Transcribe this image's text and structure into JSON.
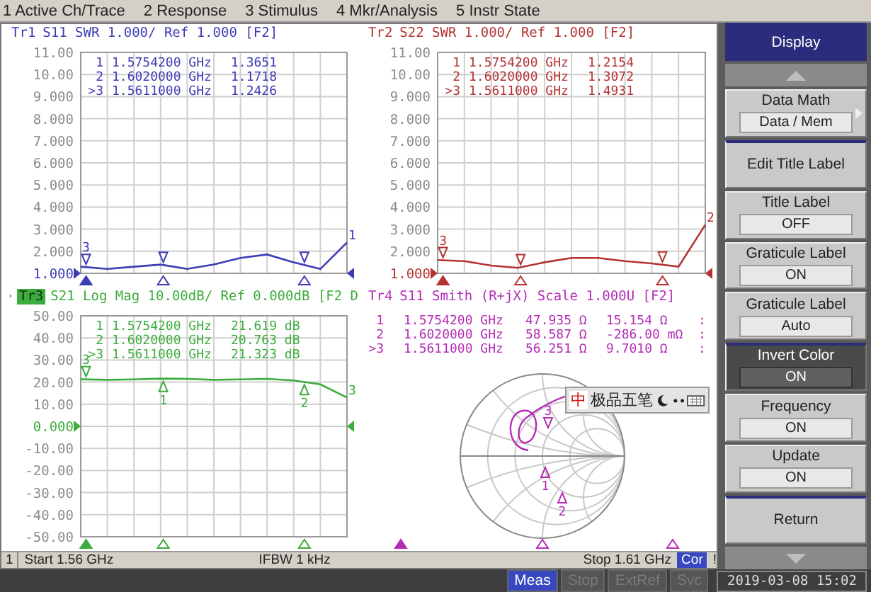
{
  "menu": [
    {
      "label": "1 Active Ch/Trace"
    },
    {
      "label": "2 Response"
    },
    {
      "label": "3 Stimulus"
    },
    {
      "label": "4 Mkr/Analysis"
    },
    {
      "label": "5 Instr State"
    }
  ],
  "traces": [
    {
      "kind": "swr",
      "badge": "Tr1",
      "active": false,
      "color": "#3c3cb4",
      "end_label": "1",
      "markers": [
        {
          "label": "1",
          "frequency": "1.5754200 GHz",
          "values": [
            "1.3651"
          ],
          "active": false
        },
        {
          "label": "2",
          "frequency": "1.6020000 GHz",
          "values": [
            "1.1718"
          ],
          "active": false
        },
        {
          "kind": "above",
          "label": ">3",
          "frequency": "1.5611000 GHz",
          "values": [
            "1.2426"
          ],
          "active": true,
          "plot_label": "3"
        }
      ],
      "chart_data": {
        "type": "line",
        "title": "S11 SWR 1.000/ Ref 1.000 [F2]",
        "grid": true,
        "categories": [
          null,
          null,
          null,
          null,
          null,
          null,
          null,
          null,
          null,
          null,
          null
        ],
        "ylim": [
          1,
          11
        ],
        "series": [
          {
            "color": "#3c3cb4",
            "values": [
              1.3,
              1.2,
              1.3,
              1.4,
              1.2,
              1.4,
              1.7,
              1.85,
              1.5,
              1.2,
              2.4
            ]
          }
        ],
        "yticks": [
          {
            "value": 1,
            "label": "1.000"
          },
          {
            "value": 2,
            "label": "2.000"
          },
          {
            "value": 3,
            "label": "3.000"
          },
          {
            "value": 4,
            "label": "4.000"
          },
          {
            "value": 5,
            "label": "5.000"
          },
          {
            "value": 6,
            "label": "6.000"
          },
          {
            "value": 7,
            "label": "7.000"
          },
          {
            "value": 8,
            "label": "8.000"
          },
          {
            "value": 9,
            "label": "9.000"
          },
          {
            "value": 10,
            "label": "10.00"
          },
          {
            "value": 11,
            "label": "11.00"
          }
        ]
      }
    },
    {
      "kind": "swr",
      "badge": "Tr2",
      "active": false,
      "color": "#b43232",
      "end_label": "2",
      "markers": [
        {
          "label": "1",
          "frequency": "1.5754200 GHz",
          "values": [
            "1.2154"
          ],
          "active": false
        },
        {
          "label": "2",
          "frequency": "1.6020000 GHz",
          "values": [
            "1.3072"
          ],
          "active": false
        },
        {
          "kind": "above",
          "label": ">3",
          "frequency": "1.5611000 GHz",
          "values": [
            "1.4931"
          ],
          "active": true,
          "plot_label": "3"
        }
      ],
      "chart_data": {
        "type": "line",
        "title": "S22 SWR 1.000/ Ref 1.000 [F2]",
        "grid": true,
        "categories": [
          null,
          null,
          null,
          null,
          null,
          null,
          null,
          null,
          null,
          null,
          null
        ],
        "ylim": [
          1,
          11
        ],
        "series": [
          {
            "color": "#b43232",
            "values": [
              1.6,
              1.55,
              1.35,
              1.25,
              1.5,
              1.7,
              1.7,
              1.55,
              1.45,
              1.3,
              3.2
            ]
          }
        ],
        "yticks": [
          {
            "value": 1,
            "label": "1.000"
          },
          {
            "value": 2,
            "label": "2.000"
          },
          {
            "value": 3,
            "label": "3.000"
          },
          {
            "value": 4,
            "label": "4.000"
          },
          {
            "value": 5,
            "label": "5.000"
          },
          {
            "value": 6,
            "label": "6.000"
          },
          {
            "value": 7,
            "label": "7.000"
          },
          {
            "value": 8,
            "label": "8.000"
          },
          {
            "value": 9,
            "label": "9.000"
          },
          {
            "value": 10,
            "label": "10.00"
          },
          {
            "value": 11,
            "label": "11.00"
          }
        ]
      }
    },
    {
      "kind": "logmag",
      "badge": "Tr3",
      "active": true,
      "color": "#3cac3c",
      "end_label": "3",
      "markers": [
        {
          "kind": "below",
          "label": "1",
          "frequency": "1.5754200 GHz",
          "values": [
            "21.619 dB"
          ],
          "active": false,
          "plot_label": "1"
        },
        {
          "kind": "below",
          "label": "2",
          "frequency": "1.6020000 GHz",
          "values": [
            "20.763 dB"
          ],
          "active": false,
          "plot_label": "2"
        },
        {
          "kind": "above",
          "label": ">3",
          "frequency": "1.5611000 GHz",
          "values": [
            "21.323 dB"
          ],
          "active": true,
          "plot_label": "3"
        }
      ],
      "chart_data": {
        "type": "line",
        "title": "S21 Log Mag 10.00dB/ Ref 0.000dB [F2 D",
        "grid": true,
        "categories": [
          null,
          null,
          null,
          null,
          null,
          null,
          null,
          null,
          null,
          null,
          null
        ],
        "ylim": [
          -50,
          50
        ],
        "series": [
          {
            "color": "#3cac3c",
            "values": [
              21.3,
              21.0,
              21.2,
              21.6,
              21.5,
              21.0,
              21.2,
              21.5,
              20.8,
              19,
              13
            ]
          }
        ],
        "yticks": [
          {
            "value": -50,
            "label": "-50.00"
          },
          {
            "value": -40,
            "label": "-40.00"
          },
          {
            "value": -30,
            "label": "-30.00"
          },
          {
            "value": -20,
            "label": "-20.00"
          },
          {
            "value": -10,
            "label": "-10.00"
          },
          {
            "value": 0,
            "label": "0.000"
          },
          {
            "value": 10,
            "label": "10.00"
          },
          {
            "value": 20,
            "label": "20.00"
          },
          {
            "value": 30,
            "label": "30.00"
          },
          {
            "value": 40,
            "label": "40.00"
          },
          {
            "value": 50,
            "label": "50.00"
          }
        ]
      }
    },
    {
      "kind": "smith",
      "badge": "Tr4",
      "title": "S11 Smith (R+jX) Scale 1.000U [F2]",
      "active": false,
      "color": "#b42cb4",
      "markers": [
        {
          "kind": "below",
          "label": "1",
          "frequency": "1.5754200 GHz",
          "values": [
            "47.935 Ω",
            "15.154 Ω"
          ],
          "suffix": ":",
          "active": false,
          "plot_label": "1"
        },
        {
          "kind": "below",
          "label": "2",
          "frequency": "1.6020000 GHz",
          "values": [
            "58.587 Ω",
            "-286.00 mΩ"
          ],
          "suffix": ":",
          "active": false,
          "plot_label": "2"
        },
        {
          "kind": "above",
          "label": ">3",
          "frequency": "1.5611000 GHz",
          "values": [
            "56.251 Ω",
            "9.7010 Ω"
          ],
          "suffix": ":",
          "active": true,
          "plot_label": "3"
        }
      ],
      "ime_toolbar": {
        "mode": "中",
        "name": "极品五笔"
      }
    }
  ],
  "channel_bar": {
    "channel": "1",
    "start": "Start 1.56 GHz",
    "ifbw": "IFBW 1 kHz",
    "stop": "Stop 1.61 GHz",
    "correction": "Cor",
    "warning": "!"
  },
  "softkeys": {
    "title": "Display",
    "items": [
      {
        "kind": "submenu",
        "label": "Data Math",
        "value": "Data / Mem",
        "selected": false,
        "separator": false
      },
      {
        "kind": "action",
        "label": "Edit Title Label",
        "selected": false,
        "separator": true
      },
      {
        "kind": "toggle",
        "label": "Title Label",
        "value": "OFF",
        "selected": false,
        "separator": false
      },
      {
        "kind": "toggle",
        "label": "Graticule Label",
        "value": "ON",
        "selected": false,
        "separator": false
      },
      {
        "kind": "toggle",
        "label": "Graticule Label",
        "value": "Auto",
        "selected": false,
        "separator": false
      },
      {
        "kind": "toggle",
        "label": "Invert Color",
        "value": "ON",
        "selected": true,
        "separator": true
      },
      {
        "kind": "toggle",
        "label": "Frequency",
        "value": "ON",
        "selected": false,
        "separator": false
      },
      {
        "kind": "toggle",
        "label": "Update",
        "value": "ON",
        "selected": false,
        "separator": false
      },
      {
        "kind": "action",
        "label": "Return",
        "selected": false,
        "separator": true
      }
    ]
  },
  "status_bar": {
    "items": [
      {
        "label": "Meas",
        "active": true
      },
      {
        "label": "Stop",
        "active": false
      },
      {
        "label": "ExtRef",
        "active": false
      },
      {
        "label": "Svc",
        "active": false
      }
    ],
    "datetime": "2019-03-08 15:02"
  }
}
